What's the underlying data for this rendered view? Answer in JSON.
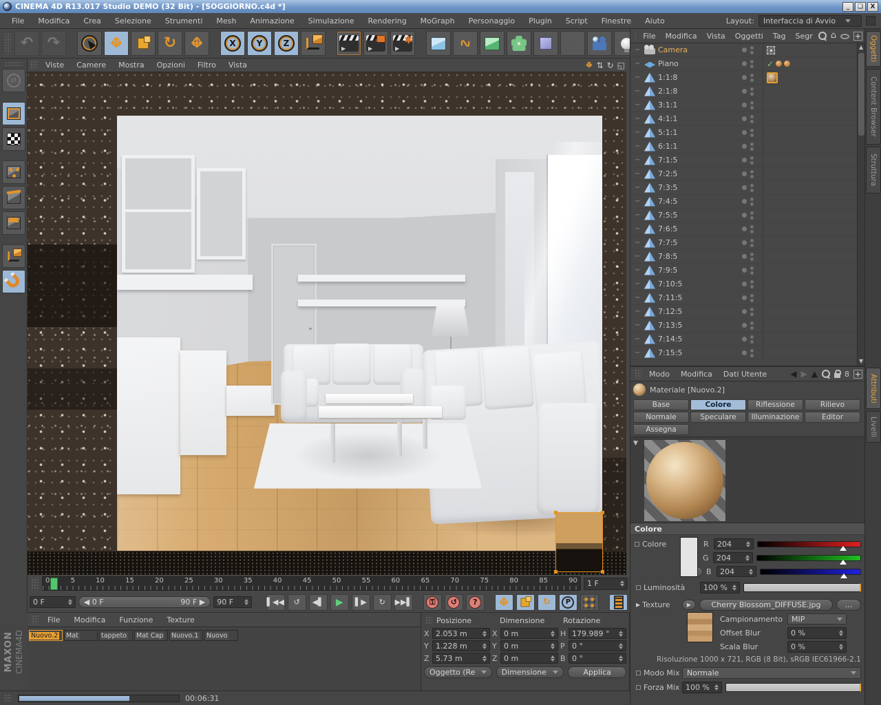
{
  "colors": {
    "accent_orange": "#e8972c",
    "highlight_blue": "#9db9d6",
    "record_red": "#d98078",
    "play_green": "#5fd07a"
  },
  "window": {
    "title": "CINEMA 4D R13.017 Studio DEMO (32 Bit) - [SOGGIORNO.c4d *]",
    "buttons": [
      "_",
      "❏",
      "X"
    ]
  },
  "menubar": {
    "items": [
      "File",
      "Modifica",
      "Crea",
      "Selezione",
      "Strumenti",
      "Mesh",
      "Animazione",
      "Simulazione",
      "Rendering",
      "MoGraph",
      "Personaggio",
      "Plugin",
      "Script",
      "Finestre",
      "Aiuto"
    ]
  },
  "layout_selector": {
    "label": "Layout:",
    "value": "Interfaccia di Avvio"
  },
  "toolbar": {
    "axis_x": "X",
    "axis_y": "Y",
    "axis_z": "Z"
  },
  "viewport": {
    "menu": [
      "Viste",
      "Camere",
      "Mostra",
      "Opzioni",
      "Filtro",
      "Vista"
    ]
  },
  "object_manager": {
    "menu": [
      "File",
      "Modifica",
      "Vista",
      "Oggetti",
      "Tag",
      "Segr"
    ],
    "side_tabs": [
      {
        "label": "Oggetti",
        "selected": true
      },
      {
        "label": "Content Browser"
      },
      {
        "label": "Struttura"
      }
    ],
    "objects": [
      {
        "name": "Camera",
        "icon": "camera",
        "tag": "target",
        "selected": true
      },
      {
        "name": "Piano",
        "icon": "plane",
        "tag": "check"
      },
      {
        "name": "1:1:8",
        "icon": "cone",
        "tag": "material"
      },
      {
        "name": "2:1:8",
        "icon": "cone"
      },
      {
        "name": "3:1:1",
        "icon": "cone"
      },
      {
        "name": "4:1:1",
        "icon": "cone"
      },
      {
        "name": "5:1:1",
        "icon": "cone"
      },
      {
        "name": "6:1:1",
        "icon": "cone"
      },
      {
        "name": "7:1:5",
        "icon": "cone"
      },
      {
        "name": "7:2:5",
        "icon": "cone"
      },
      {
        "name": "7:3:5",
        "icon": "cone"
      },
      {
        "name": "7:4:5",
        "icon": "cone"
      },
      {
        "name": "7:5:5",
        "icon": "cone"
      },
      {
        "name": "7:6:5",
        "icon": "cone"
      },
      {
        "name": "7:7:5",
        "icon": "cone"
      },
      {
        "name": "7:8:5",
        "icon": "cone"
      },
      {
        "name": "7:9:5",
        "icon": "cone"
      },
      {
        "name": "7:10:5",
        "icon": "cone"
      },
      {
        "name": "7:11:5",
        "icon": "cone"
      },
      {
        "name": "7:12:5",
        "icon": "cone"
      },
      {
        "name": "7:13:5",
        "icon": "cone"
      },
      {
        "name": "7:14:5",
        "icon": "cone"
      },
      {
        "name": "7:15:5",
        "icon": "cone"
      }
    ]
  },
  "attribute_manager": {
    "menu": [
      "Modo",
      "Modifica",
      "Dati Utente"
    ],
    "side_tabs": [
      {
        "label": "Attributi",
        "selected": true
      },
      {
        "label": "Livelli"
      }
    ],
    "title": "Materiale [Nuovo.2]",
    "tabs": [
      {
        "label": "Base"
      },
      {
        "label": "Colore",
        "selected": true
      },
      {
        "label": "Riflessione"
      },
      {
        "label": "Rilievo"
      },
      {
        "label": "Normale"
      },
      {
        "label": "Speculare"
      },
      {
        "label": "Illuminazione"
      },
      {
        "label": "Editor"
      },
      {
        "label": "Assegna"
      }
    ],
    "color_section": {
      "header": "Colore",
      "color_label": "Colore",
      "r_label": "R",
      "r_value": "204",
      "g_label": "G",
      "g_value": "204",
      "b_label": "B",
      "b_value": "204",
      "luminosity_label": "Luminosità",
      "luminosity_value": "100 %"
    },
    "texture_section": {
      "label": "Texture",
      "file": "Cherry Blossom_DIFFUSE.jpg",
      "more": "...",
      "sampling_label": "Campionamento",
      "sampling_value": "MIP",
      "offset_blur_label": "Offset Blur",
      "offset_blur_value": "0 %",
      "scale_blur_label": "Scala Blur",
      "scale_blur_value": "0 %",
      "resolution": "Risoluzione 1000 x 721, RGB (8 Bit), sRGB IEC61966-2.1",
      "mix_mode_label": "Modo Mix",
      "mix_mode_value": "Normale",
      "mix_strength_label": "Forza Mix",
      "mix_strength_value": "100 %"
    }
  },
  "materials_panel": {
    "menu": [
      "File",
      "Modifica",
      "Funzione",
      "Texture"
    ],
    "items": [
      {
        "name": "Nuovo.2",
        "kind": "wood-sphere",
        "selected": true
      },
      {
        "name": "Mat",
        "kind": "white-sphere"
      },
      {
        "name": "tappeto",
        "kind": "rough-sphere"
      },
      {
        "name": "Mat Cap",
        "kind": "wood-strip"
      },
      {
        "name": "Nuovo.1",
        "kind": "white-ball"
      },
      {
        "name": "Nuovo",
        "kind": "glass"
      }
    ]
  },
  "coordinates_panel": {
    "columns": [
      "Posizione",
      "Dimensione",
      "Rotazione"
    ],
    "pos_x_label": "X",
    "pos_x": "2.053 m",
    "pos_y_label": "Y",
    "pos_y": "1.228 m",
    "pos_z_label": "Z",
    "pos_z": "5.73 m",
    "size_x_label": "X",
    "size_x": "0 m",
    "size_y_label": "Y",
    "size_y": "0 m",
    "size_z_label": "Z",
    "size_z": "0 m",
    "rot_h_label": "H",
    "rot_h": "179.989 °",
    "rot_p_label": "P",
    "rot_p": "0 °",
    "rot_b_label": "B",
    "rot_b": "0 °",
    "object_dropdown": "Oggetto (Re",
    "size_dropdown": "Dimensione",
    "apply_button": "Applica"
  },
  "timeline": {
    "ticks": [
      "0",
      "5",
      "10",
      "15",
      "20",
      "25",
      "30",
      "35",
      "40",
      "45",
      "50",
      "55",
      "60",
      "65",
      "70",
      "75",
      "80",
      "85",
      "90"
    ],
    "current_frame": "1 F",
    "range_start_field": "0 F",
    "range_start": "0 F",
    "range_end": "90 F",
    "range_end_field": "90 F"
  },
  "status_bar": {
    "time": "00:06:31"
  },
  "brand": {
    "maxon": "MAXON",
    "cinema": "CINEMA4D"
  }
}
